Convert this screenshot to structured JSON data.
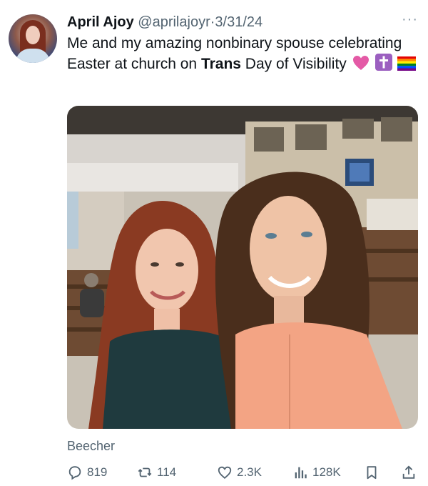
{
  "author": {
    "name": "April Ajoy",
    "handle": "@aprilajoyr",
    "separator": "·",
    "date": "3/31/24"
  },
  "more_label": "···",
  "text": {
    "part1": "Me and my amazing nonbinary spouse celebrating Easter at church on ",
    "bold": "Trans",
    "part2": " Day of Visibility"
  },
  "emojis": [
    "pink-heart-icon",
    "cross-icon",
    "rainbow-flag-icon"
  ],
  "caption": "Beecher",
  "actions": {
    "replies": "819",
    "reposts": "114",
    "likes": "2.3K",
    "views": "128K"
  },
  "colors": {
    "text": "#0f1419",
    "muted": "#536471",
    "heart": "#e45aa6",
    "cross_bg": "#9b5fc0"
  }
}
